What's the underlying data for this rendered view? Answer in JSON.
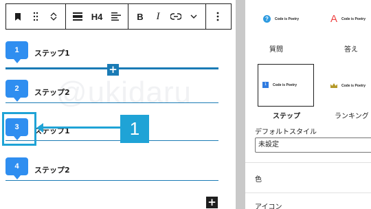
{
  "toolbar": {
    "heading_level": "H4",
    "bold": "B",
    "italic": "I"
  },
  "steps": [
    {
      "number": "1",
      "label": "ステップ1"
    },
    {
      "number": "2",
      "label": "ステップ2"
    },
    {
      "number": "3",
      "label": "ステップ1"
    },
    {
      "number": "4",
      "label": "ステップ2"
    }
  ],
  "annotation": {
    "callout_number": "1"
  },
  "watermark": "@ukidaru",
  "sidebar": {
    "styles": [
      {
        "label": "質問",
        "preview_text": "Code is Poetry",
        "preview_icon": "question-circle-icon"
      },
      {
        "label": "答え",
        "preview_text": "Code is Poetry",
        "preview_icon": "letter-a-icon"
      },
      {
        "label": "ステップ",
        "preview_text": "Code is Poetry",
        "preview_icon": "step-number-icon",
        "preview_number": "1",
        "selected": true
      },
      {
        "label": "ランキング",
        "preview_text": "Code is Poetry",
        "preview_icon": "crown-icon"
      }
    ],
    "default_style_label": "デフォルトスタイル",
    "default_style_value": "未設定",
    "color_label": "色",
    "icon_label": "アイコン"
  },
  "colors": {
    "accent": "#1a7bb5",
    "badge": "#2f8ef0",
    "annotation": "#1fa3d6"
  }
}
